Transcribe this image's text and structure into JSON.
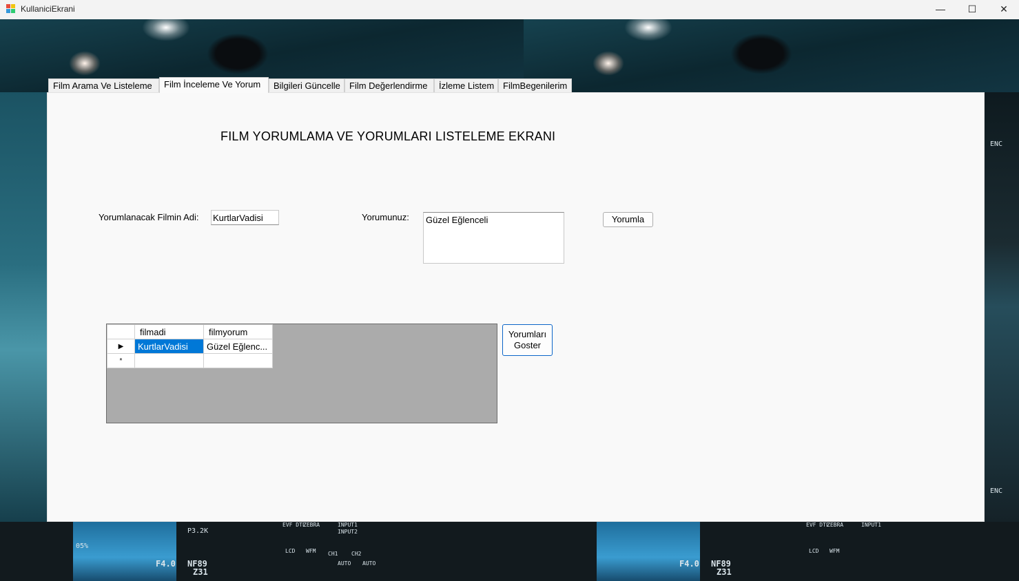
{
  "window": {
    "title": "KullaniciEkrani",
    "controls": {
      "minimize": "—",
      "maximize": "☐",
      "close": "✕"
    }
  },
  "tabs": [
    {
      "label": "Film Arama Ve Listeleme",
      "active": false
    },
    {
      "label": "Film İnceleme Ve Yorum",
      "active": true
    },
    {
      "label": "Bilgileri Güncelle",
      "active": false
    },
    {
      "label": "Film Değerlendirme",
      "active": false
    },
    {
      "label": "İzleme Listem",
      "active": false
    },
    {
      "label": "FilmBegenilerim",
      "active": false
    }
  ],
  "page": {
    "heading": "FILM YORUMLAMA VE YORUMLARI LISTELEME EKRANI",
    "film_name_label": "Yorumlanacak Filmin Adi:",
    "film_name_value": "KurtlarVadisi",
    "comment_label": "Yorumunuz:",
    "comment_value": "Güzel Eğlenceli",
    "comment_button": "Yorumla",
    "show_comments_button_line1": "Yorumları",
    "show_comments_button_line2": "Goster"
  },
  "grid": {
    "columns": [
      "filmadi",
      "filmyorum"
    ],
    "rows": [
      {
        "marker": "▶",
        "cells": [
          "KurtlarVadisi",
          "Güzel Eğlenc..."
        ]
      }
    ],
    "new_row_marker": "*"
  },
  "background": {
    "hud_left": [
      "F4.0",
      "NF89",
      "Z31",
      "05%",
      "P3.2K"
    ],
    "hud_panel": [
      "EVF DTL",
      "ZEBRA",
      "INPUT1",
      "INPUT2",
      "LCD",
      "WFM",
      "CH1",
      "CH2",
      "AUTO",
      "AUTO"
    ]
  },
  "colors": {
    "selection": "#0078d7",
    "panel": "#f9f9f9",
    "grid_bg": "#ababab",
    "accent_focus": "#0a64c8"
  }
}
